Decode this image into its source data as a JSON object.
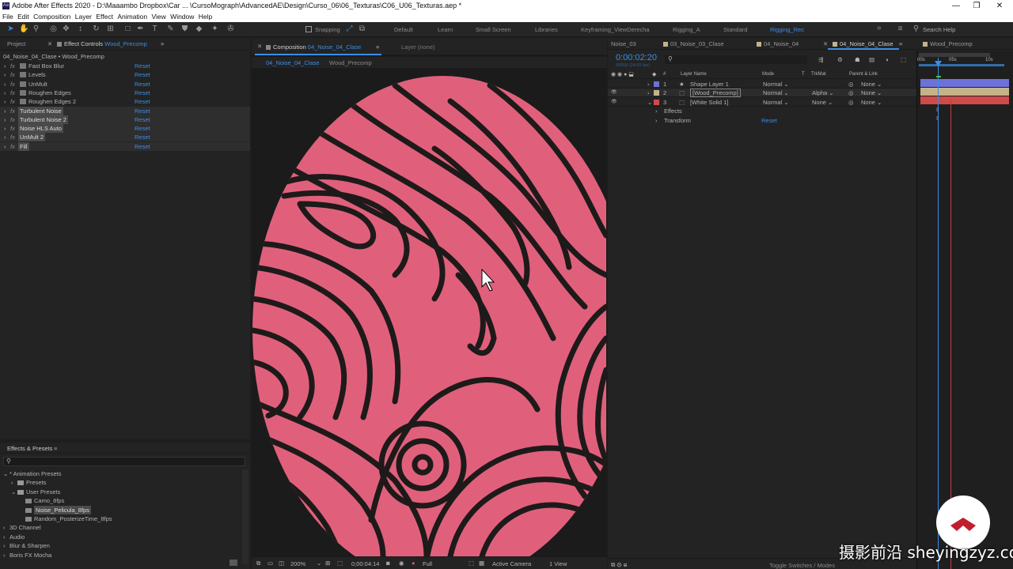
{
  "title_bar": {
    "app_icon": "Ae",
    "title": "Adobe After Effects 2020 - D:\\Maaambo Dropbox\\Car ... \\CursoMograph\\AdvancedAE\\Design\\Curso_06\\06_Texturas\\C06_U06_Texturas.aep *",
    "minimize": "—",
    "maximize": "❐",
    "close": "✕"
  },
  "menu": [
    "File",
    "Edit",
    "Composition",
    "Layer",
    "Effect",
    "Animation",
    "View",
    "Window",
    "Help"
  ],
  "toolbar": {
    "snapping": "Snapping",
    "workspaces": [
      "Default",
      "Learn",
      "Small Screen",
      "Libraries",
      "Keyframing_ViewDerecha",
      "Rigging_A",
      "Standard",
      "Rigging_Rec"
    ],
    "overflow": "»",
    "search_placeholder": "Search Help"
  },
  "colors": {
    "accent": "#3a8ee6",
    "active_ws": "#3a8ee6",
    "pink": "#e0607b",
    "lines": "#1e1a1a",
    "label_blue": "#6c72d8",
    "label_tan": "#c4b38a",
    "label_red": "#d04a4a",
    "playhead": "#3a8ee6"
  },
  "project_tab": "Project",
  "effect_controls": {
    "tab_label": "Effect Controls",
    "tab_layer": "Wood_Precomp",
    "header": "04_Noise_04_Clase • Wood_Precomp",
    "effects": [
      {
        "name": "Fast Box Blur",
        "highlight": false
      },
      {
        "name": "Levels",
        "highlight": false
      },
      {
        "name": "UnMult",
        "highlight": false
      },
      {
        "name": "Roughen Edges",
        "highlight": false
      },
      {
        "name": "Roughen Edges 2",
        "highlight": false
      },
      {
        "name": "Turbulent Noise",
        "highlight": true
      },
      {
        "name": "Turbulent Noise 2",
        "highlight": true
      },
      {
        "name": "Noise HLS Auto",
        "highlight": true
      },
      {
        "name": "UnMult 2",
        "highlight": true
      },
      {
        "name": "Fill",
        "highlight": true
      }
    ],
    "reset_label": "Reset"
  },
  "effects_presets": {
    "tab": "Effects & Presets",
    "tree": [
      {
        "label": "* Animation Presets",
        "indent": 0,
        "kind": "open"
      },
      {
        "label": "Presets",
        "indent": 1,
        "kind": "folder"
      },
      {
        "label": "User Presets",
        "indent": 1,
        "kind": "folder-open"
      },
      {
        "label": "Camo_8fps",
        "indent": 2,
        "kind": "preset"
      },
      {
        "label": "Noise_Pelicula_8fps",
        "indent": 2,
        "kind": "preset",
        "selected": true
      },
      {
        "label": "Random_PosterizeTime_8fps",
        "indent": 2,
        "kind": "preset"
      },
      {
        "label": "3D Channel",
        "indent": 0,
        "kind": "closed"
      },
      {
        "label": "Audio",
        "indent": 0,
        "kind": "closed"
      },
      {
        "label": "Blur & Sharpen",
        "indent": 0,
        "kind": "closed"
      },
      {
        "label": "Boris FX Mocha",
        "indent": 0,
        "kind": "closed"
      }
    ]
  },
  "composition": {
    "tab_label": "Composition",
    "tab_comp": "04_Noise_04_Clase",
    "layer_tab": "Layer (none)",
    "breadcrumb": [
      "04_Noise_04_Clase",
      "Wood_Precomp"
    ],
    "footer": {
      "zoom": "200%",
      "timecode": "0;00:04:14",
      "resolution": "Full",
      "camera": "Active Camera",
      "view": "1 View"
    }
  },
  "timeline": {
    "tabs": [
      "Noise_03",
      "03_Noise_03_Clase",
      "04_Noise_04",
      "04_Noise_04_Clase",
      "Wood_Precomp"
    ],
    "active_tab": 3,
    "timecode": "0:00:02:20",
    "frames": "00068 (24.00 fps)",
    "columns": {
      "layer_name": "Layer Name",
      "mode": "Mode",
      "t": "T",
      "trkmat": "TrkMat",
      "parent": "Parent & Link"
    },
    "layers": [
      {
        "num": "1",
        "name": "Shape Layer 1",
        "mode": "Normal",
        "trkmat": "",
        "parent": "None",
        "label_color": "#6c72d8"
      },
      {
        "num": "2",
        "name": "[Wood_Precomp]",
        "mode": "Normal",
        "trkmat": "Alpha",
        "parent": "None",
        "label_color": "#c4b38a"
      },
      {
        "num": "3",
        "name": "[White Solid 1]",
        "mode": "Normal",
        "trkmat": "None",
        "parent": "None",
        "label_color": "#d04a4a"
      }
    ],
    "sub_rows": [
      {
        "label": "Effects"
      },
      {
        "label": "Transform",
        "reset": "Reset"
      }
    ],
    "ruler": [
      "00s",
      "05s",
      "10s"
    ],
    "footer": "Toggle Switches / Modes"
  },
  "watermark": "摄影前沿 sheyingzyz.com"
}
